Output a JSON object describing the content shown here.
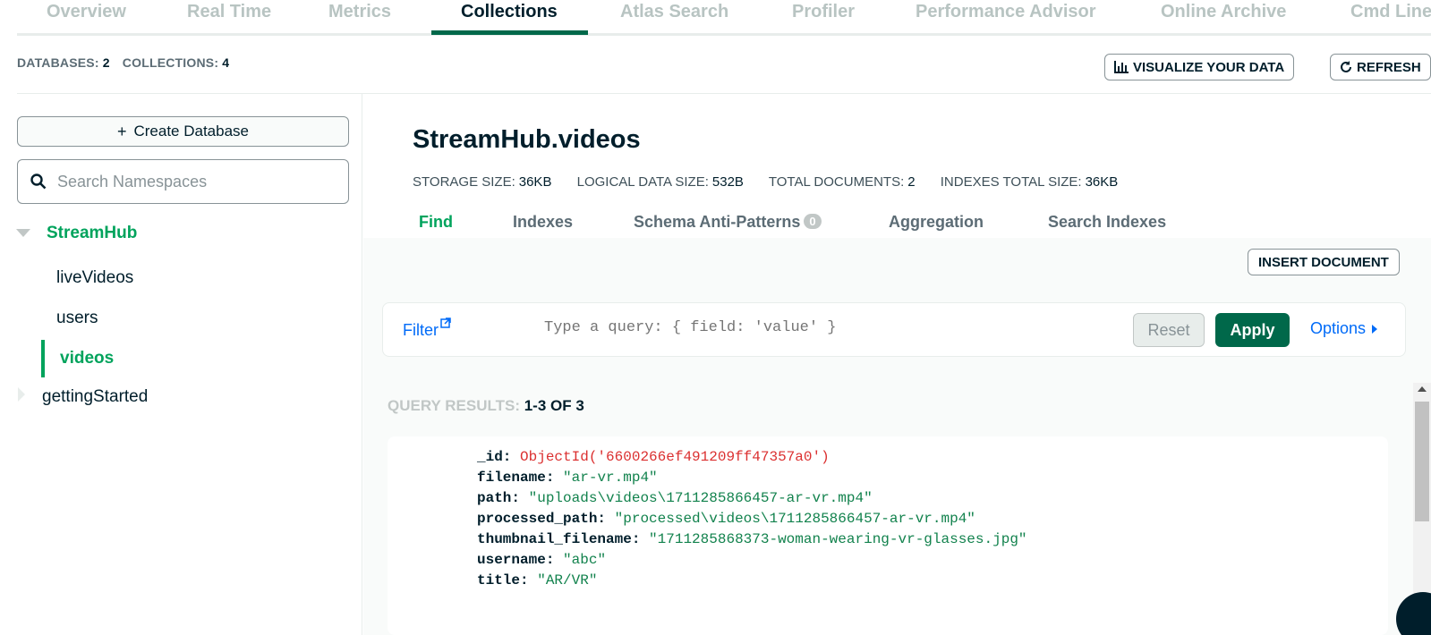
{
  "top_tabs": [
    "Overview",
    "Real Time",
    "Metrics",
    "Collections",
    "Atlas Search",
    "Profiler",
    "Performance Advisor",
    "Online Archive",
    "Cmd Line"
  ],
  "active_top_tab": "Collections",
  "stats": {
    "databases_label": "DATABASES:",
    "databases_value": "2",
    "collections_label": "COLLECTIONS:",
    "collections_value": "4"
  },
  "header_buttons": {
    "visualize": "VISUALIZE YOUR DATA",
    "refresh": "REFRESH"
  },
  "sidebar": {
    "create_db_label": "Create Database",
    "search_placeholder": "Search Namespaces",
    "databases": [
      {
        "name": "StreamHub",
        "expanded": true,
        "collections": [
          "liveVideos",
          "users",
          "videos"
        ],
        "active_collection": "videos"
      },
      {
        "name": "gettingStarted",
        "expanded": false
      }
    ]
  },
  "collection": {
    "title": "StreamHub.videos",
    "storage_size_label": "STORAGE SIZE:",
    "storage_size": "36KB",
    "logical_size_label": "LOGICAL DATA SIZE:",
    "logical_size": "532B",
    "total_docs_label": "TOTAL DOCUMENTS:",
    "total_docs": "2",
    "indexes_size_label": "INDEXES TOTAL SIZE:",
    "indexes_size": "36KB"
  },
  "sub_tabs": [
    "Find",
    "Indexes",
    "Schema Anti-Patterns",
    "Aggregation",
    "Search Indexes"
  ],
  "schema_badge": "0",
  "active_sub_tab": "Find",
  "insert_document_label": "INSERT DOCUMENT",
  "filter": {
    "label": "Filter",
    "placeholder": "Type a query: { field: 'value' }",
    "reset_label": "Reset",
    "apply_label": "Apply",
    "options_label": "Options"
  },
  "results": {
    "label": "QUERY RESULTS:",
    "value": "1-3 OF 3"
  },
  "document": [
    {
      "key": "_id:",
      "value": "ObjectId('6600266ef491209ff47357a0')",
      "kind": "oid"
    },
    {
      "key": "filename:",
      "value": "\"ar-vr.mp4\"",
      "kind": "str"
    },
    {
      "key": "path:",
      "value": "\"uploads\\videos\\1711285866457-ar-vr.mp4\"",
      "kind": "str"
    },
    {
      "key": "processed_path:",
      "value": "\"processed\\videos\\1711285866457-ar-vr.mp4\"",
      "kind": "str"
    },
    {
      "key": "thumbnail_filename:",
      "value": "\"1711285868373-woman-wearing-vr-glasses.jpg\"",
      "kind": "str"
    },
    {
      "key": "username:",
      "value": "\"abc\"",
      "kind": "str"
    },
    {
      "key": "title:",
      "value": "\"AR/VR\"",
      "kind": "str"
    }
  ],
  "colors": {
    "accent": "#00a35c",
    "brand_dark": "#00684a",
    "link": "#016bf8",
    "oid": "#db3030",
    "string": "#12824d"
  }
}
